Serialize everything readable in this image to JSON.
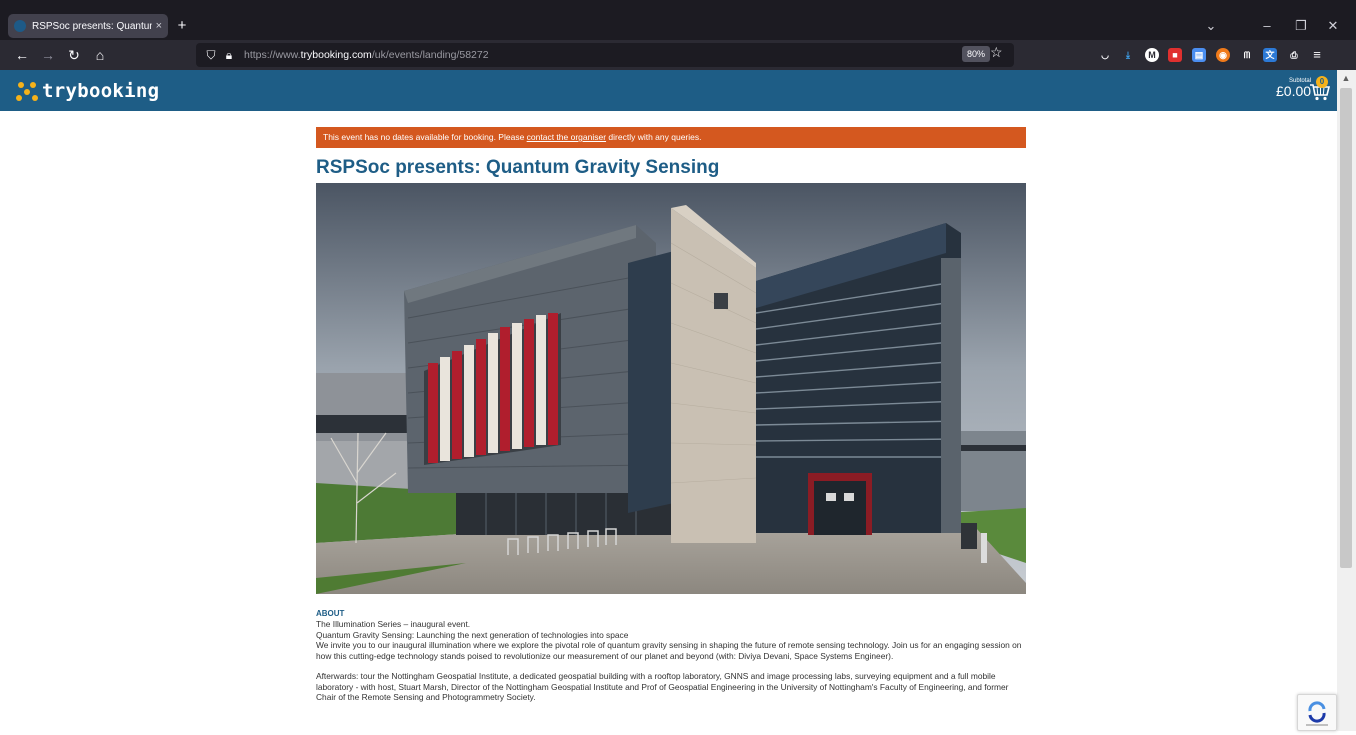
{
  "browser": {
    "tab_title": "RSPSoc presents: Quantum Gr",
    "tab_close": "×",
    "new_tab": "+",
    "url_prefix": "https://www.",
    "url_domain": "trybooking.com",
    "url_path": "/uk/events/landing/58272",
    "zoom": "80%"
  },
  "site": {
    "logo_text": "trybooking",
    "subtotal_label": "Subtotal",
    "subtotal_amount": "£0.00",
    "cart_count": "0",
    "brand_color": "#1e5d86",
    "accent_color": "#f5b21b",
    "alert_color": "#d4581f"
  },
  "alert": {
    "before": "This event has no dates available for booking. Please ",
    "link": "contact the organiser",
    "after": " directly with any queries."
  },
  "event": {
    "title": "RSPSoc presents: Quantum Gravity Sensing",
    "about_label": "ABOUT",
    "about_lines": [
      "The Illumination Series – inaugural event.",
      "Quantum Gravity Sensing: Launching the next generation of technologies into space",
      "We invite you to our inaugural illumination where we explore the pivotal role of quantum gravity sensing in shaping the future of remote sensing technology. Join us for an engaging session on how this cutting-edge technology stands poised to revolutionize our measurement of our planet and beyond (with: Diviya Devani, Space Systems Engineer).",
      "Afterwards: tour the Nottingham Geospatial Institute, a dedicated geospatial building with a rooftop laboratory, GNNS and image processing labs, surveying equipment and a full mobile laboratory - with host, Stuart Marsh, Director of the Nottingham Geospatial Institute and Prof of Geospatial Engineering in the University of Nottingham's Faculty of Engineering, and former Chair of the Remote Sensing and Photogrammetry Society."
    ]
  }
}
